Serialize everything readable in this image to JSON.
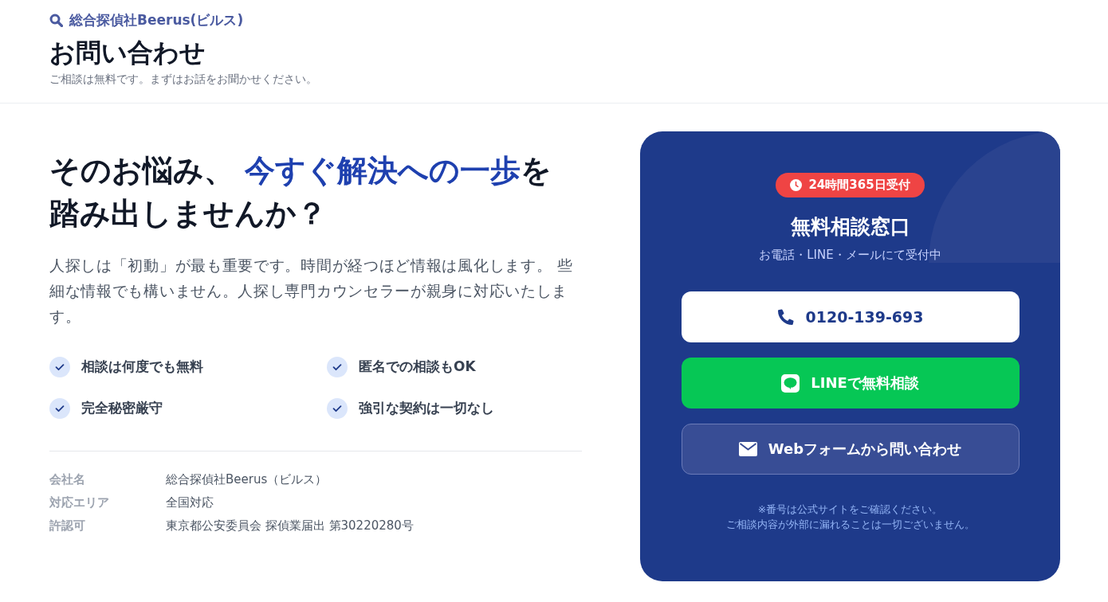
{
  "header": {
    "brand": "総合探偵社Beerus(ビルス)",
    "title": "お問い合わせ",
    "subtitle": "ご相談は無料です。まずはお話をお聞かせください。"
  },
  "hero": {
    "headline_lines": [
      [
        {
          "text": "そのお悩み、 ",
          "highlight": false
        },
        {
          "text": "今すぐ解決への一歩",
          "highlight": true
        },
        {
          "text": "を",
          "highlight": false
        }
      ],
      [
        {
          "text": "踏み出しませんか？",
          "highlight": false
        }
      ]
    ],
    "lead": "人探しは「初動」が最も重要です。時間が経つほど情報は風化します。 些細な情報でも構いません。人探し専門カウンセラーが親身に対応いたします。",
    "features": [
      "相談は何度でも無料",
      "匿名での相談もOK",
      "完全秘密厳守",
      "強引な契約は一切なし"
    ]
  },
  "company_info": [
    {
      "label": "会社名",
      "value": "総合探偵社Beerus（ビルス）"
    },
    {
      "label": "対応エリア",
      "value": "全国対応"
    },
    {
      "label": "許認可",
      "value": "東京都公安委員会 探偵業届出 第30220280号"
    }
  ],
  "contact_card": {
    "badge": "24時間365日受付",
    "title": "無料相談窓口",
    "subtitle": "お電話・LINE・メールにて受付中",
    "buttons": [
      {
        "kind": "phone",
        "label": "0120-139-693"
      },
      {
        "kind": "line",
        "label": "LINEで無料相談"
      },
      {
        "kind": "web",
        "label": "Webフォームから問い合わせ"
      }
    ],
    "notes": [
      "※番号は公式サイトをご確認ください。",
      "ご相談内容が外部に漏れることは一切ございません。"
    ]
  }
}
